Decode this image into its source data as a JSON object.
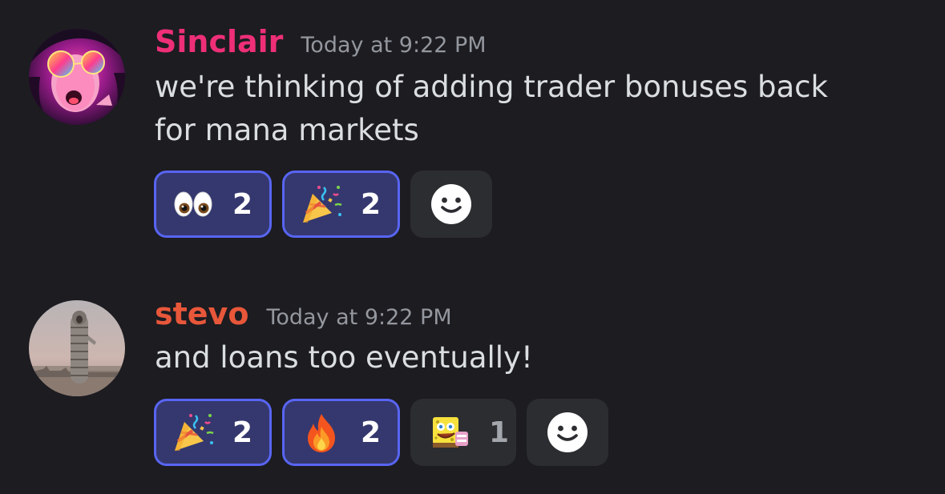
{
  "messages": [
    {
      "author": "Sinclair",
      "author_color": "#ee2f78",
      "timestamp": "Today at 9:22 PM",
      "text": "we're thinking of adding trader bonuses back for mana markets",
      "reactions": [
        {
          "emoji": "eyes-emoji",
          "count": "2",
          "reacted_by_me": true
        },
        {
          "emoji": "party-popper-emoji",
          "count": "2",
          "reacted_by_me": true
        }
      ]
    },
    {
      "author": "stevo",
      "author_color": "#e8573a",
      "timestamp": "Today at 9:22 PM",
      "text": "and loans too eventually!",
      "reactions": [
        {
          "emoji": "party-popper-emoji",
          "count": "2",
          "reacted_by_me": true
        },
        {
          "emoji": "fire-emoji",
          "count": "2",
          "reacted_by_me": true
        },
        {
          "emoji": "spongebob-custom-emoji",
          "count": "1",
          "reacted_by_me": false
        }
      ]
    }
  ],
  "colors": {
    "background": "#1c1c21",
    "reaction_active_bg": "#35386e",
    "reaction_active_border": "#5865f2",
    "reaction_inactive_bg": "#2b2d31",
    "timestamp": "#94979e"
  },
  "icons": {
    "add_reaction": "smiley-face-icon"
  }
}
